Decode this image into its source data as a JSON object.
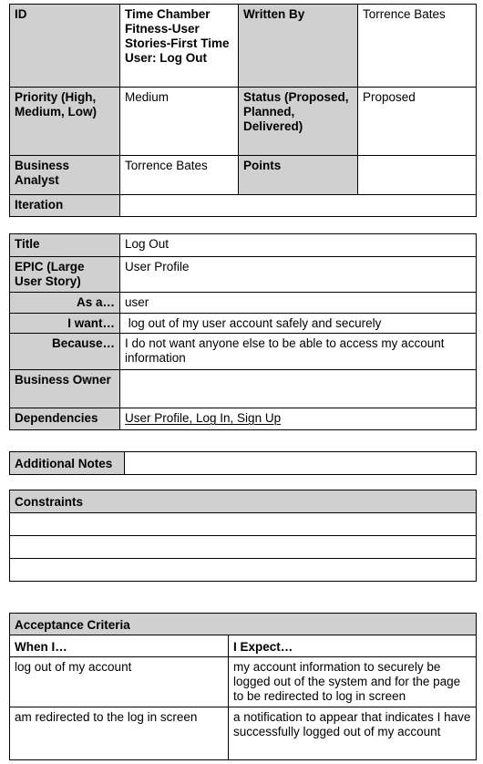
{
  "header_table": {
    "id_label": "ID",
    "id_value": "Time Chamber Fitness-User Stories-First Time User: Log Out",
    "written_by_label": "Written By",
    "written_by_value": "Torrence Bates",
    "priority_label": "Priority (High, Medium, Low)",
    "priority_value": "Medium",
    "status_label": "Status (Proposed, Planned, Delivered)",
    "status_value": "Proposed",
    "analyst_label": "Business Analyst",
    "analyst_value": "Torrence Bates",
    "points_label": "Points",
    "points_value": "",
    "iteration_label": "Iteration",
    "iteration_value": ""
  },
  "story_table": {
    "title_label": "Title",
    "title_value": "Log Out",
    "epic_label": "EPIC (Large User Story)",
    "epic_value": "User Profile",
    "as_a_label": "As a…",
    "as_a_value": "user",
    "i_want_label": "I want…",
    "i_want_value": " log out of my user account safely and securely",
    "because_label": "Because…",
    "because_value": "I do not want anyone else to be able to access my account information",
    "owner_label": "Business Owner",
    "owner_value": "",
    "dependencies_label": "Dependencies",
    "dependencies_value": "User Profile, Log In, Sign Up"
  },
  "notes_table": {
    "label": "Additional Notes",
    "value": ""
  },
  "constraints_table": {
    "label": "Constraints",
    "rows": [
      "",
      "",
      ""
    ]
  },
  "acceptance_table": {
    "label": "Acceptance Criteria",
    "col_when": "When I…",
    "col_expect": "I Expect…",
    "rows": [
      {
        "when": "log out of my account",
        "expect": "my account information to securely be logged out of the system and for the page to be redirected to log in screen"
      },
      {
        "when": "am redirected to the log in screen",
        "expect": "a notification to appear that indicates I have successfully logged out of my account"
      }
    ]
  }
}
